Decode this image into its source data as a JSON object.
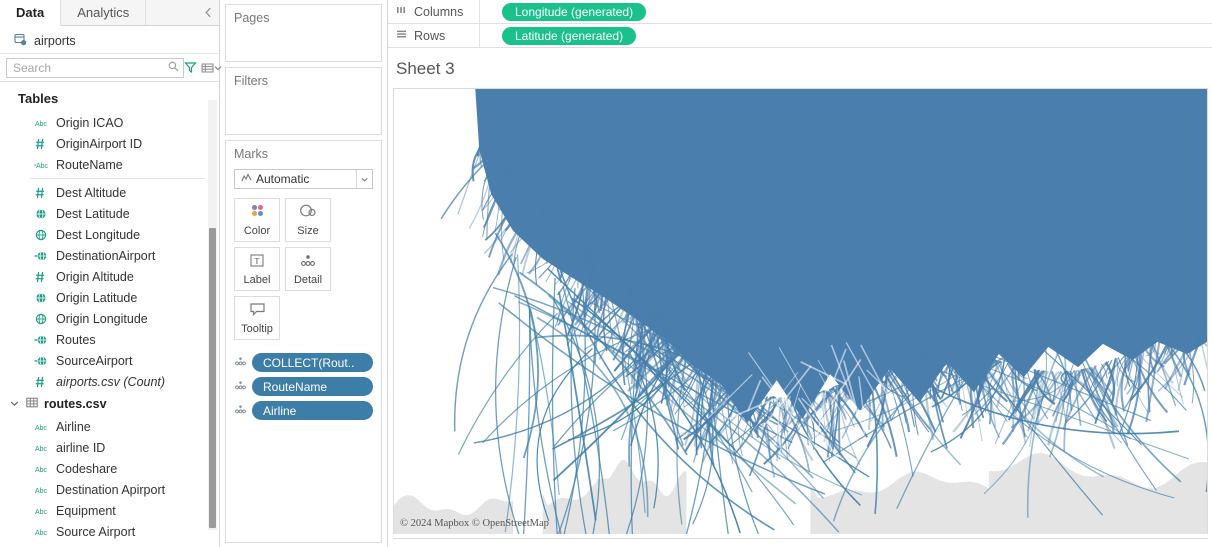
{
  "left_pane": {
    "tabs": [
      {
        "label": "Data",
        "active": true
      },
      {
        "label": "Analytics",
        "active": false
      }
    ],
    "collapse_icon": "chevron-left-icon",
    "datasource": {
      "name": "airports",
      "icon": "datasource-icon"
    },
    "search": {
      "placeholder": "Search",
      "value": "",
      "icons": [
        "search-icon",
        "filter-funnel-icon",
        "grid-view-icon",
        "caret-down-icon"
      ]
    },
    "section_header": "Tables",
    "fields": [
      {
        "label": "Origin ICAO",
        "icon": "abc",
        "italic": false
      },
      {
        "label": "OriginAirport ID",
        "icon": "hash",
        "italic": false
      },
      {
        "label": "RouteName",
        "icon": "abc-group",
        "italic": false
      },
      {
        "divider": true
      },
      {
        "label": "Dest Altitude",
        "icon": "hash",
        "italic": false
      },
      {
        "label": "Dest Latitude",
        "icon": "globe",
        "italic": false
      },
      {
        "label": "Dest Longitude",
        "icon": "globe-open",
        "italic": false
      },
      {
        "label": "DestinationAirport",
        "icon": "globe-link",
        "italic": false
      },
      {
        "label": "Origin Altitude",
        "icon": "hash",
        "italic": false
      },
      {
        "label": "Origin Latitude",
        "icon": "globe",
        "italic": false
      },
      {
        "label": "Origin Longitude",
        "icon": "globe-open",
        "italic": false
      },
      {
        "label": "Routes",
        "icon": "globe-link",
        "italic": false
      },
      {
        "label": "SourceAirport",
        "icon": "globe-link",
        "italic": false
      },
      {
        "label": "airports.csv (Count)",
        "icon": "hash",
        "italic": true
      }
    ],
    "table_group": {
      "name": "routes.csv",
      "expanded": true,
      "chevron": "chevron-down-icon",
      "icon": "table-icon",
      "fields": [
        {
          "label": "Airline",
          "icon": "abc"
        },
        {
          "label": "airline ID",
          "icon": "abc"
        },
        {
          "label": "Codeshare",
          "icon": "abc"
        },
        {
          "label": "Destination Apirport",
          "icon": "abc"
        },
        {
          "label": "Equipment",
          "icon": "abc"
        },
        {
          "label": "Source Airport",
          "icon": "abc"
        }
      ]
    }
  },
  "cards": {
    "pages": {
      "title": "Pages"
    },
    "filters": {
      "title": "Filters"
    },
    "marks": {
      "title": "Marks",
      "mark_type": {
        "label": "Automatic",
        "icon": "automatic-marks-icon",
        "arrow": "caret-down-icon"
      },
      "properties": [
        {
          "label": "Color",
          "icon": "color-palette-icon"
        },
        {
          "label": "Size",
          "icon": "size-circles-icon"
        },
        {
          "label": "Label",
          "icon": "label-text-icon"
        },
        {
          "label": "Detail",
          "icon": "detail-dots-icon"
        },
        {
          "label": "Tooltip",
          "icon": "tooltip-bubble-icon"
        }
      ],
      "pills": [
        {
          "label": "COLLECT(Rout..",
          "icon": "detail-dots-icon"
        },
        {
          "label": "RouteName",
          "icon": "detail-dots-icon"
        },
        {
          "label": "Airline",
          "icon": "detail-dots-icon"
        }
      ]
    }
  },
  "shelves": [
    {
      "name": "Columns",
      "icon": "columns-icon",
      "pill": "Longitude (generated)"
    },
    {
      "name": "Rows",
      "icon": "rows-icon",
      "pill": "Latitude (generated)"
    }
  ],
  "worksheet": {
    "title": "Sheet 3",
    "attribution": "© 2024 Mapbox © OpenStreetMap"
  },
  "colors": {
    "route_blue": "#3d7ea8",
    "dense_blue": "#4a7ead",
    "pill_green": "#1ac18b",
    "field_teal": "#1b9e86",
    "land_gray": "#e4e4e4",
    "pane_border": "#d4d4d4"
  }
}
